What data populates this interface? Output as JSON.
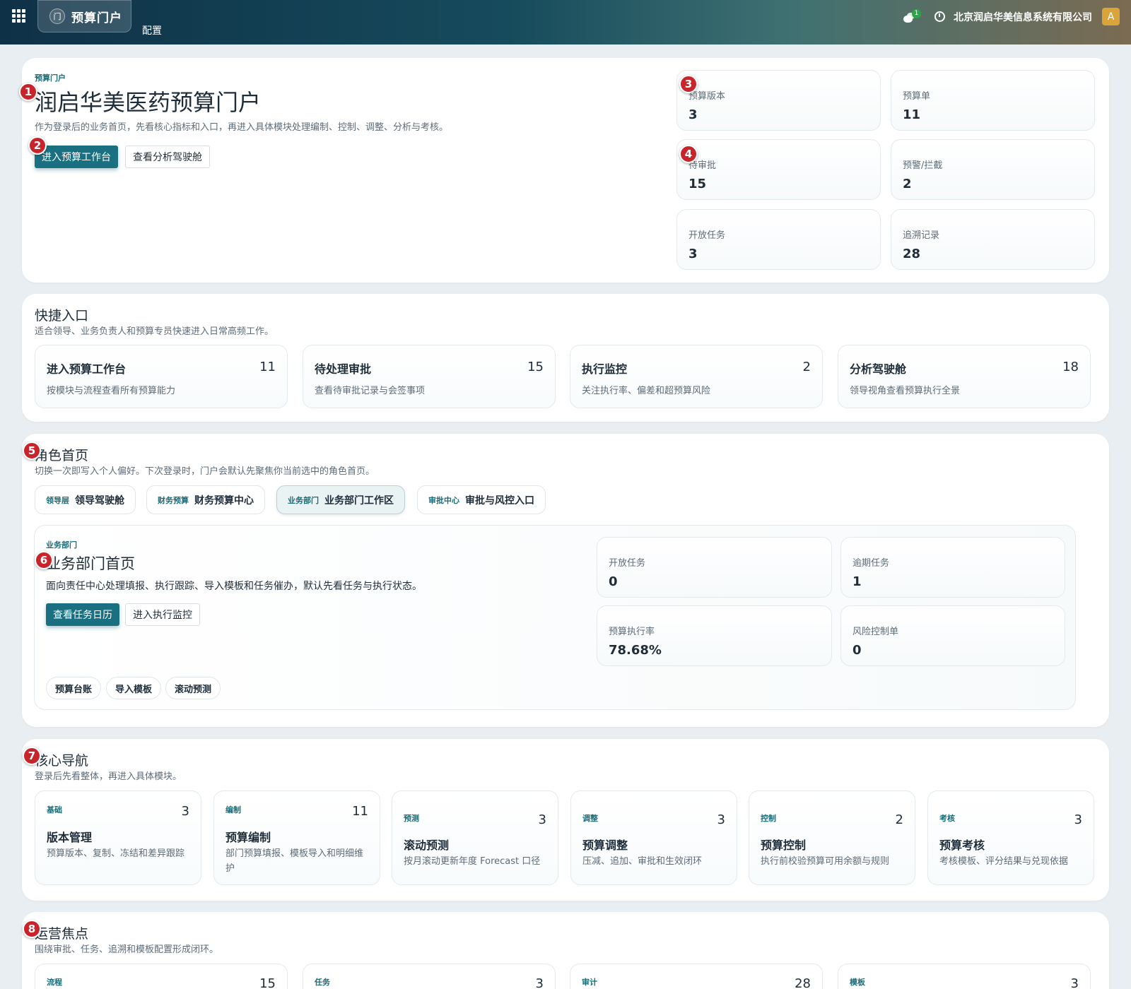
{
  "topbar": {
    "app_name": "预算门户",
    "app_glyph": "门",
    "config_label": "配置",
    "chat_badge": "1",
    "company": "北京润启华美信息系统有限公司",
    "avatar_letter": "A"
  },
  "hero": {
    "eyebrow": "预算门户",
    "title": "润启华美医药预算门户",
    "subtitle": "作为登录后的业务首页，先看核心指标和入口，再进入具体模块处理编制、控制、调整、分析与考核。",
    "primary_button": "进入预算工作台",
    "secondary_button": "查看分析驾驶舱",
    "stats": [
      {
        "label": "预算版本",
        "value": "3"
      },
      {
        "label": "预算单",
        "value": "11"
      },
      {
        "label": "待审批",
        "value": "15"
      },
      {
        "label": "预警/拦截",
        "value": "2"
      },
      {
        "label": "开放任务",
        "value": "3"
      },
      {
        "label": "追溯记录",
        "value": "28"
      }
    ]
  },
  "quick": {
    "title": "快捷入口",
    "subtitle": "适合领导、业务负责人和预算专员快速进入日常高频工作。",
    "tiles": [
      {
        "title": "进入预算工作台",
        "count": "11",
        "desc": "按模块与流程查看所有预算能力"
      },
      {
        "title": "待处理审批",
        "count": "15",
        "desc": "查看待审批记录与会签事项"
      },
      {
        "title": "执行监控",
        "count": "2",
        "desc": "关注执行率、偏差和超预算风险"
      },
      {
        "title": "分析驾驶舱",
        "count": "18",
        "desc": "领导视角查看预算执行全景"
      }
    ]
  },
  "roles": {
    "title": "角色首页",
    "subtitle": "切换一次即写入个人偏好。下次登录时，门户会默认先聚焦你当前选中的角色首页。",
    "tabs": [
      {
        "tag": "领导层",
        "name": "领导驾驶舱"
      },
      {
        "tag": "财务预算",
        "name": "财务预算中心"
      },
      {
        "tag": "业务部门",
        "name": "业务部门工作区"
      },
      {
        "tag": "审批中心",
        "name": "审批与风控入口"
      }
    ],
    "panel": {
      "eyebrow": "业务部门",
      "title": "业务部门首页",
      "desc": "面向责任中心处理填报、执行跟踪、导入模板和任务催办，默认先看任务与执行状态。",
      "primary_button": "查看任务日历",
      "secondary_button": "进入执行监控",
      "stats": [
        {
          "label": "开放任务",
          "value": "0"
        },
        {
          "label": "逾期任务",
          "value": "1"
        },
        {
          "label": "预算执行率",
          "value": "78.68%"
        },
        {
          "label": "风险控制单",
          "value": "0"
        }
      ],
      "chips": [
        "预算台账",
        "导入模板",
        "滚动预测"
      ]
    }
  },
  "nav": {
    "title": "核心导航",
    "subtitle": "登录后先看整体，再进入具体模块。",
    "tiles": [
      {
        "tag": "基础",
        "count": "3",
        "title": "版本管理",
        "desc": "预算版本、复制、冻结和差异跟踪"
      },
      {
        "tag": "编制",
        "count": "11",
        "title": "预算编制",
        "desc": "部门预算填报、模板导入和明细维护"
      },
      {
        "tag": "预测",
        "count": "3",
        "title": "滚动预测",
        "desc": "按月滚动更新年度 Forecast 口径"
      },
      {
        "tag": "调整",
        "count": "3",
        "title": "预算调整",
        "desc": "压减、追加、审批和生效闭环"
      },
      {
        "tag": "控制",
        "count": "2",
        "title": "预算控制",
        "desc": "执行前校验预算可用余额与规则"
      },
      {
        "tag": "考核",
        "count": "3",
        "title": "预算考核",
        "desc": "考核模板、评分结果与兑现依据"
      }
    ]
  },
  "ops": {
    "title": "运营焦点",
    "subtitle": "围绕审批、任务、追溯和模板配置形成闭环。",
    "tiles": [
      {
        "tag": "流程",
        "count": "15"
      },
      {
        "tag": "任务",
        "count": "3"
      },
      {
        "tag": "审计",
        "count": "28"
      },
      {
        "tag": "模板",
        "count": "3"
      }
    ]
  },
  "markers": [
    "1",
    "2",
    "3",
    "4",
    "5",
    "6",
    "7",
    "8"
  ]
}
